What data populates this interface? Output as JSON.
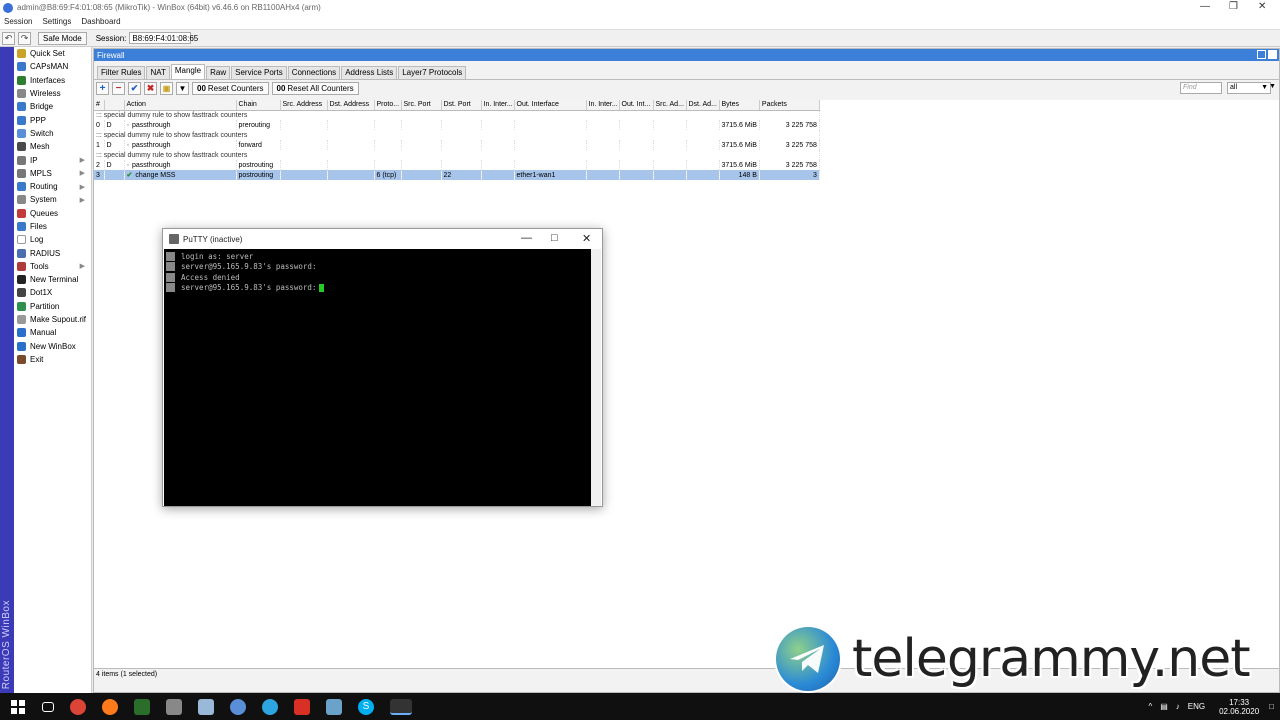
{
  "window": {
    "title": "admin@B8:69:F4:01:08:65 (MikroTik) - WinBox (64bit) v6.46.6 on RB1100AHx4 (arm)"
  },
  "menubar": [
    "Session",
    "Settings",
    "Dashboard"
  ],
  "toolbar": {
    "safe_mode": "Safe Mode",
    "session_label": "Session:",
    "session_value": "B8:69:F4:01:08:65"
  },
  "brand": "RouterOS WinBox",
  "sidebar": {
    "items": [
      {
        "label": "Quick Set",
        "icon": "quickset-icon",
        "color": "#c9a227",
        "arrow": false
      },
      {
        "label": "CAPsMAN",
        "icon": "capsman-icon",
        "color": "#3a78c9",
        "arrow": false
      },
      {
        "label": "Interfaces",
        "icon": "interfaces-icon",
        "color": "#2f7d2f",
        "arrow": false
      },
      {
        "label": "Wireless",
        "icon": "wireless-icon",
        "color": "#888888",
        "arrow": false
      },
      {
        "label": "Bridge",
        "icon": "bridge-icon",
        "color": "#3a78c9",
        "arrow": false
      },
      {
        "label": "PPP",
        "icon": "ppp-icon",
        "color": "#3a78c9",
        "arrow": false
      },
      {
        "label": "Switch",
        "icon": "switch-icon",
        "color": "#5a8fd8",
        "arrow": false
      },
      {
        "label": "Mesh",
        "icon": "mesh-icon",
        "color": "#4a4a4a",
        "arrow": false
      },
      {
        "label": "IP",
        "icon": "ip-icon",
        "color": "#777777",
        "arrow": true
      },
      {
        "label": "MPLS",
        "icon": "mpls-icon",
        "color": "#777777",
        "arrow": true
      },
      {
        "label": "Routing",
        "icon": "routing-icon",
        "color": "#3a78c9",
        "arrow": true
      },
      {
        "label": "System",
        "icon": "system-icon",
        "color": "#888888",
        "arrow": true
      },
      {
        "label": "Queues",
        "icon": "queues-icon",
        "color": "#c23b3b",
        "arrow": false
      },
      {
        "label": "Files",
        "icon": "files-icon",
        "color": "#3a78c9",
        "arrow": false
      },
      {
        "label": "Log",
        "icon": "log-icon",
        "color": "#ffffff",
        "arrow": false
      },
      {
        "label": "RADIUS",
        "icon": "radius-icon",
        "color": "#4a6fb0",
        "arrow": false
      },
      {
        "label": "Tools",
        "icon": "tools-icon",
        "color": "#b03a3a",
        "arrow": true
      },
      {
        "label": "New Terminal",
        "icon": "terminal-icon",
        "color": "#222222",
        "arrow": false
      },
      {
        "label": "Dot1X",
        "icon": "dot1x-icon",
        "color": "#444444",
        "arrow": false
      },
      {
        "label": "Partition",
        "icon": "partition-icon",
        "color": "#2f8f4f",
        "arrow": false
      },
      {
        "label": "Make Supout.rif",
        "icon": "supout-icon",
        "color": "#999999",
        "arrow": false
      },
      {
        "label": "Manual",
        "icon": "manual-icon",
        "color": "#2a6fc9",
        "arrow": false
      },
      {
        "label": "New WinBox",
        "icon": "newwinbox-icon",
        "color": "#2a6fc9",
        "arrow": false
      },
      {
        "label": "Exit",
        "icon": "exit-icon",
        "color": "#7a4a2a",
        "arrow": false
      }
    ]
  },
  "firewall": {
    "title": "Firewall",
    "tabs": [
      "Filter Rules",
      "NAT",
      "Mangle",
      "Raw",
      "Service Ports",
      "Connections",
      "Address Lists",
      "Layer7 Protocols"
    ],
    "active_tab": "Mangle",
    "reset_counters": "Reset Counters",
    "reset_all_counters": "Reset All Counters",
    "find_placeholder": "Find",
    "filter_value": "all",
    "columns": [
      "#",
      "",
      "Action",
      "Chain",
      "Src. Address",
      "Dst. Address",
      "Proto...",
      "Src. Port",
      "Dst. Port",
      "In. Inter...",
      "Out. Interface",
      "In. Inter...",
      "Out. Int...",
      "Src. Ad...",
      "Dst. Ad...",
      "Bytes",
      "Packets"
    ],
    "rows": [
      {
        "type": "comment",
        "text": "::: special dummy rule to show fasttrack counters"
      },
      {
        "type": "rule",
        "num": "0",
        "flag": "D",
        "action": "passthrough",
        "chain": "prerouting",
        "proto": "",
        "dst_port": "",
        "out_iface": "",
        "bytes": "3715.6 MiB",
        "packets": "3 225 758",
        "selected": false
      },
      {
        "type": "comment",
        "text": "::: special dummy rule to show fasttrack counters"
      },
      {
        "type": "rule",
        "num": "1",
        "flag": "D",
        "action": "passthrough",
        "chain": "forward",
        "proto": "",
        "dst_port": "",
        "out_iface": "",
        "bytes": "3715.6 MiB",
        "packets": "3 225 758",
        "selected": false
      },
      {
        "type": "comment",
        "text": "::: special dummy rule to show fasttrack counters"
      },
      {
        "type": "rule",
        "num": "2",
        "flag": "D",
        "action": "passthrough",
        "chain": "postrouting",
        "proto": "",
        "dst_port": "",
        "out_iface": "",
        "bytes": "3715.6 MiB",
        "packets": "3 225 758",
        "selected": false
      },
      {
        "type": "rule",
        "num": "3",
        "flag": "",
        "action": "change MSS",
        "chain": "postrouting",
        "proto": "6 (tcp)",
        "dst_port": "22",
        "out_iface": "ether1-wan1",
        "bytes": "148 B",
        "packets": "3",
        "selected": true
      }
    ],
    "status": "4 items (1 selected)"
  },
  "putty": {
    "title": "PuTTY (inactive)",
    "lines": [
      "login as: server",
      "server@95.165.9.83's password:",
      "Access denied",
      "server@95.165.9.83's password: "
    ]
  },
  "watermark": "telegrammy.net",
  "taskbar": {
    "language": "ENG",
    "time": "17:33",
    "date": "02.06.2020"
  }
}
